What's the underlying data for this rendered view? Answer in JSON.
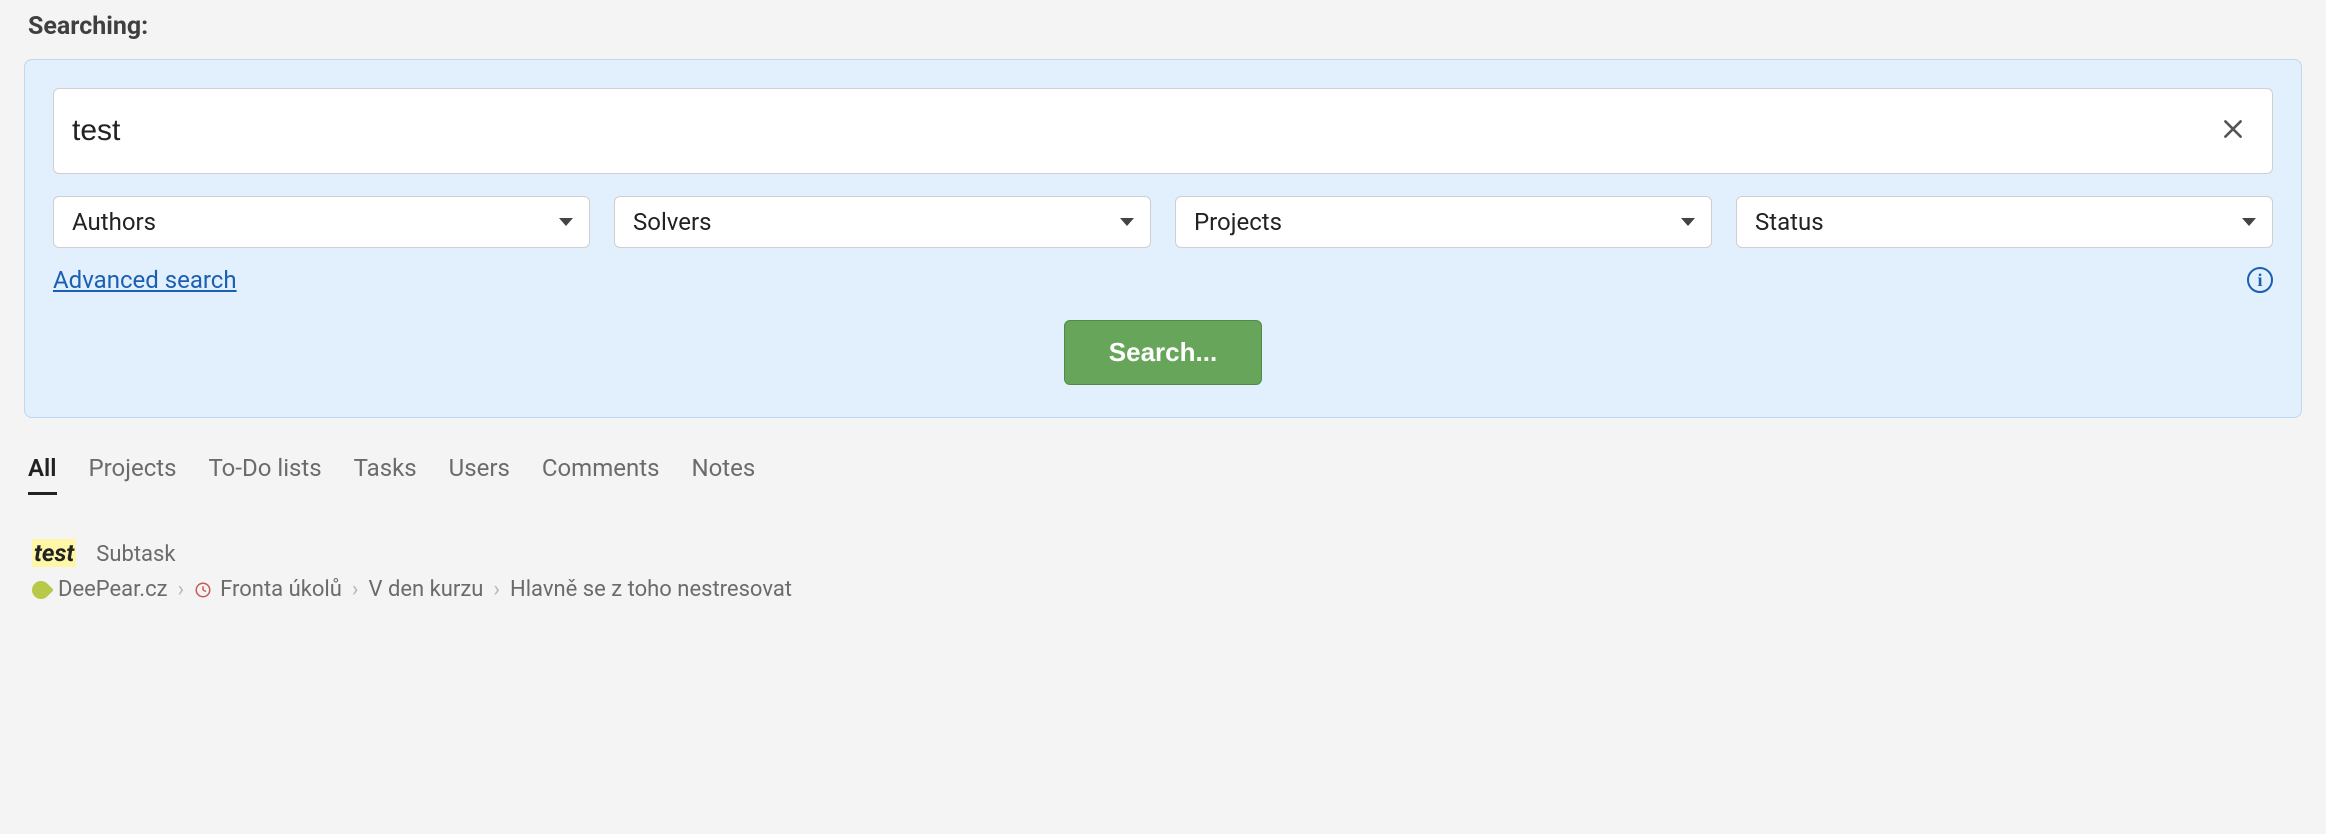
{
  "heading": "Searching:",
  "search": {
    "value": "test",
    "placeholder": ""
  },
  "filters": [
    {
      "label": "Authors"
    },
    {
      "label": "Solvers"
    },
    {
      "label": "Projects"
    },
    {
      "label": "Status"
    }
  ],
  "advanced_link": "Advanced search",
  "search_button": "Search...",
  "tabs": [
    {
      "label": "All",
      "active": true
    },
    {
      "label": "Projects",
      "active": false
    },
    {
      "label": "To-Do lists",
      "active": false
    },
    {
      "label": "Tasks",
      "active": false
    },
    {
      "label": "Users",
      "active": false
    },
    {
      "label": "Comments",
      "active": false
    },
    {
      "label": "Notes",
      "active": false
    }
  ],
  "result": {
    "title": "test",
    "type": "Subtask",
    "breadcrumb": [
      {
        "icon": "leaf",
        "label": "DeePear.cz"
      },
      {
        "icon": "clock",
        "label": "Fronta úkolů"
      },
      {
        "icon": null,
        "label": "V den kurzu"
      },
      {
        "icon": null,
        "label": "Hlavně se z toho nestresovat"
      }
    ]
  }
}
